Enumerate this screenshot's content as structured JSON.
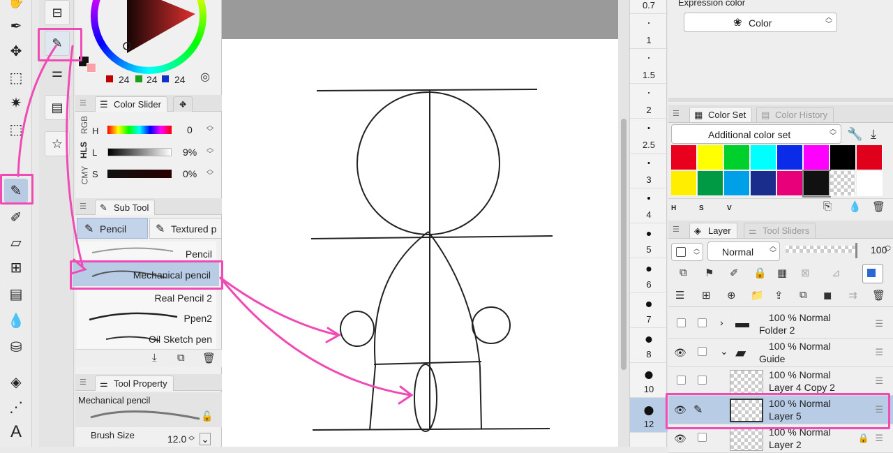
{
  "color_wheel": {
    "r": "24",
    "g": "24",
    "b": "24"
  },
  "color_slider": {
    "tab": "Color Slider",
    "modes": [
      "RGB",
      "HLS",
      "CMY"
    ],
    "rows": [
      {
        "label": "H",
        "value": "0"
      },
      {
        "label": "L",
        "value": "9%"
      },
      {
        "label": "S",
        "value": "0%"
      }
    ]
  },
  "sub_tool": {
    "tab": "Sub Tool",
    "groups": [
      "Pencil",
      "Textured p"
    ],
    "brushes": [
      "Pencil",
      "Mechanical pencil",
      "Real Pencil 2",
      "Ppen2",
      "Oil Sketch pen"
    ]
  },
  "tool_property": {
    "tab": "Tool Property",
    "tool_name": "Mechanical pencil",
    "brush_size_label": "Brush Size",
    "brush_size_value": "12.0"
  },
  "ruler": [
    "0.7",
    "1",
    "1.5",
    "2",
    "2.5",
    "3",
    "4",
    "5",
    "6",
    "7",
    "8",
    "10",
    "12"
  ],
  "expression_color": {
    "label": "Expression color",
    "value": "Color"
  },
  "color_set": {
    "tab1": "Color Set",
    "tab2": "Color History",
    "set_name": "Additional color set",
    "swatches_row1": [
      "#e8001c",
      "#ffff00",
      "#00d02c",
      "#00ffff",
      "#0a2ce8",
      "#ff00ff",
      "#000000",
      "#e0001c"
    ],
    "swatches_row2": [
      "#ffee00",
      "#009a44",
      "#00a0e8",
      "#1a2d8c",
      "#e8007a",
      "#111111",
      "checker",
      "#ffffff"
    ],
    "footer": [
      "H",
      "S",
      "V"
    ]
  },
  "layer_panel": {
    "tab1": "Layer",
    "tab2": "Tool Sliders",
    "blend_mode": "Normal",
    "opacity": "100",
    "layers": [
      {
        "opacity": "100 %",
        "mode": "Normal",
        "name": "Folder 2"
      },
      {
        "opacity": "100 %",
        "mode": "Normal",
        "name": "Guide"
      },
      {
        "opacity": "100 %",
        "mode": "Normal",
        "name": "Layer 4 Copy 2"
      },
      {
        "opacity": "100 %",
        "mode": "Normal",
        "name": "Layer 5"
      },
      {
        "opacity": "100 %",
        "mode": "Normal",
        "name": "Layer 2"
      }
    ]
  }
}
